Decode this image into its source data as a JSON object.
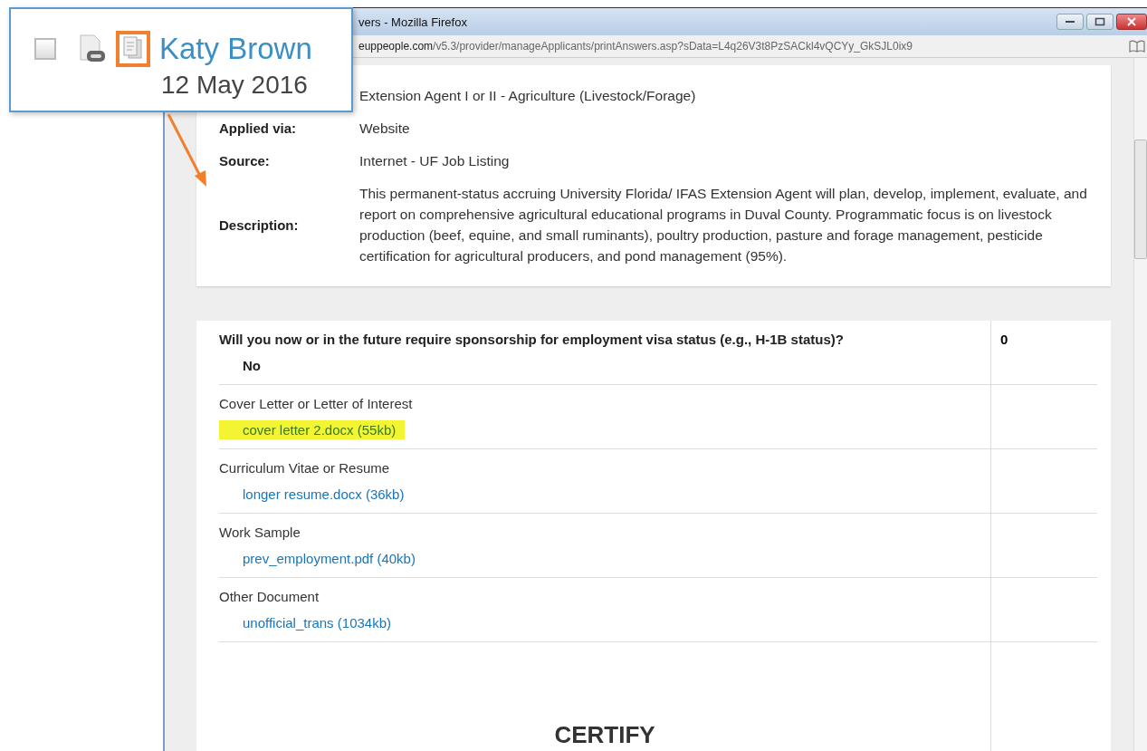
{
  "callout": {
    "checkbox": {
      "checked": false
    },
    "name": "Katy Brown",
    "date": "12 May 2016"
  },
  "window": {
    "title": "vers - Mozilla Firefox",
    "url_domain": "euppeople.com",
    "url_path": "/v5.3/provider/manageApplicants/printAnswers.asp?sData=L4q26V3t8PzSACkl4vQCYy_GkSJL0ix9"
  },
  "details": {
    "position_value": "Extension Agent I or II - Agriculture (Livestock/Forage)",
    "fields": [
      {
        "label": "Applied via:",
        "value": "Website"
      },
      {
        "label": "Source:",
        "value": "Internet - UF Job Listing"
      },
      {
        "label": "Description:",
        "value": "This permanent-status accruing University Florida/ IFAS Extension Agent will plan, develop, implement, evaluate, and report on comprehensive agricultural educational programs in Duval County. Programmatic focus is on livestock production (beef, equine, and small ruminants), poultry production, pasture and forage management, pesticide certification for agricultural producers, and pond management (95%)."
      }
    ]
  },
  "answers": [
    {
      "kind": "question",
      "question": "Will you now or in the future require sponsorship for employment visa status (e.g., H-1B status)?",
      "answer": "No",
      "score": "0"
    },
    {
      "kind": "document",
      "question": "Cover Letter or Letter of Interest",
      "answer": "cover letter 2.docx (55kb)",
      "highlighted": true
    },
    {
      "kind": "document",
      "question": "Curriculum Vitae or Resume",
      "answer": "longer resume.docx (36kb)",
      "highlighted": false
    },
    {
      "kind": "document",
      "question": "Work Sample",
      "answer": "prev_employment.pdf (40kb)",
      "highlighted": false
    },
    {
      "kind": "document",
      "question": "Other Document",
      "answer": "unofficial_trans (1034kb)",
      "highlighted": false
    }
  ],
  "certify_heading": "CERTIFY"
}
